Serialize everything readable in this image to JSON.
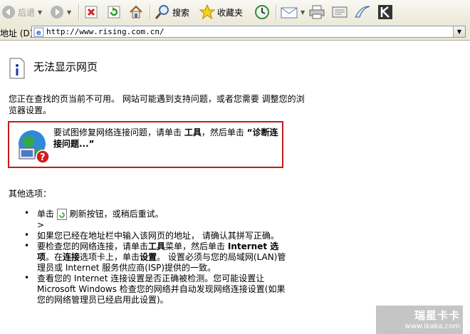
{
  "toolbar": {
    "back_label": "后退",
    "search_label": "搜索",
    "favorites_label": "收藏夹"
  },
  "address": {
    "label": "地址 (D)",
    "url": "http://www.rising.com.cn/"
  },
  "page": {
    "title": "无法显示网页",
    "message": "您正在查找的页当前不可用。 网站可能遇到支持问题，或者您需要 调整您的浏览器设置。",
    "diag_prefix": "要试图修复网络连接问题，请单击 ",
    "diag_tools": "工具",
    "diag_mid": "，然后单击 ",
    "diag_link": "“诊断连接问题...”",
    "other_options": "其他选项：",
    "opt1_a": "单击 ",
    "opt1_b": " 刷新按钮，或稍后重试。",
    "opt1_gt": ">",
    "opt2": "如果您已经在地址栏中输入该网页的地址， 请确认其拼写正确。",
    "opt3_a": "要检查您的网络连接，请单击",
    "opt3_tools": "工具",
    "opt3_b": "菜单，然后单击 ",
    "opt3_inet": "Internet 选项",
    "opt3_c": "。在",
    "opt3_conn": "连接",
    "opt3_d": "选项卡上，单击",
    "opt3_settings": "设置",
    "opt3_e": "。 设置必须与您的局域网(LAN)管理员或 Internet 服务供应商(ISP)提供的一致。",
    "opt4": "查看您的 Internet 连接设置是否正确被检测。您可能设置让 Microsoft Windows 检查您的网络并自动发现网络连接设置(如果您的网络管理员已经启用此设置)。"
  },
  "watermark": {
    "line1": "瑞星卡卡",
    "line2": "www.ikaka.com"
  },
  "colors": {
    "accent_red": "#c01c1c",
    "toolbar_bg": "#ece9d8"
  }
}
